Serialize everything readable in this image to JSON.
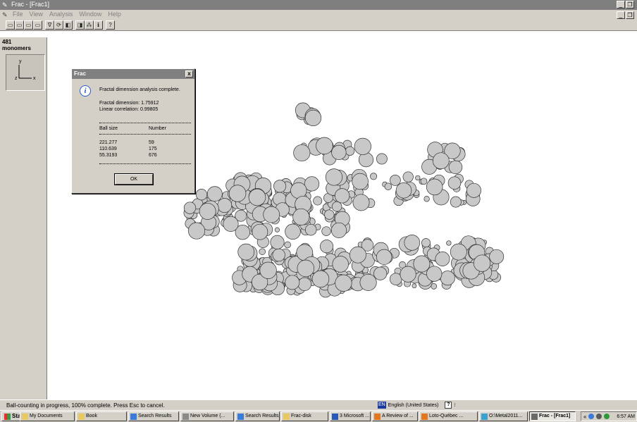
{
  "window": {
    "title": "Frac - [Frac1]",
    "controls": [
      "_",
      " ",
      "×"
    ]
  },
  "menu": {
    "items": [
      "File",
      "View",
      "Analysis",
      "Window",
      "Help"
    ]
  },
  "toolbar": {
    "icons": [
      "open-icon",
      "save-icon",
      "print-icon",
      "copy-icon",
      "filter-icon",
      "rotate-icon",
      "zoom-icon",
      "view-icon",
      "cluster-icon",
      "info-icon",
      "help-icon"
    ]
  },
  "side": {
    "count": "481",
    "unit": "monomers",
    "axis_y": "y",
    "axis_z": "z",
    "axis_x": "x"
  },
  "dialog": {
    "title": "Frac",
    "close": "x",
    "message": "Fractal dimension analysis complete.",
    "dimension": "Fractal dimension: 1.75912",
    "correlation": "Linear correlation: 0.99805",
    "col_ball": "Ball size",
    "col_number": "Number",
    "rows": [
      {
        "size": "221.277",
        "number": "59"
      },
      {
        "size": "110.639",
        "number": "175"
      },
      {
        "size": "55.3193",
        "number": "676"
      }
    ],
    "ok": "OK"
  },
  "status": {
    "text": "Ball-counting in progress, 100% complete. Press Esc to cancel.",
    "lang_code": "EN",
    "lang_name": "English (United States)"
  },
  "taskbar": {
    "start": "Start",
    "tasks": [
      {
        "label": "My Documents",
        "icon": "folder-icon",
        "color": "#e8c860"
      },
      {
        "label": "Book",
        "icon": "folder-icon",
        "color": "#e8c860"
      },
      {
        "label": "Search Results",
        "icon": "search-icon",
        "color": "#3a7ad8"
      },
      {
        "label": "New Volume (...",
        "icon": "drive-icon",
        "color": "#8a8a8a"
      },
      {
        "label": "Search Results",
        "icon": "search-icon",
        "color": "#3a7ad8"
      },
      {
        "label": "Frac-disk",
        "icon": "folder-icon",
        "color": "#e8c860"
      },
      {
        "label": "3 Microsoft ...",
        "icon": "word-icon",
        "color": "#2a58b8"
      },
      {
        "label": "A Review of ...",
        "icon": "browser-icon",
        "color": "#e07820"
      },
      {
        "label": "Loto-Québec ...",
        "icon": "browser-icon",
        "color": "#e07820"
      },
      {
        "label": "O:\\Metal2011...",
        "icon": "folder-icon",
        "color": "#3aa0d0"
      },
      {
        "label": "Frac - [Frac1]",
        "icon": "frac-icon",
        "color": "#6a6a6a"
      }
    ],
    "clock": "6:57 AM",
    "tray_more": "«"
  }
}
